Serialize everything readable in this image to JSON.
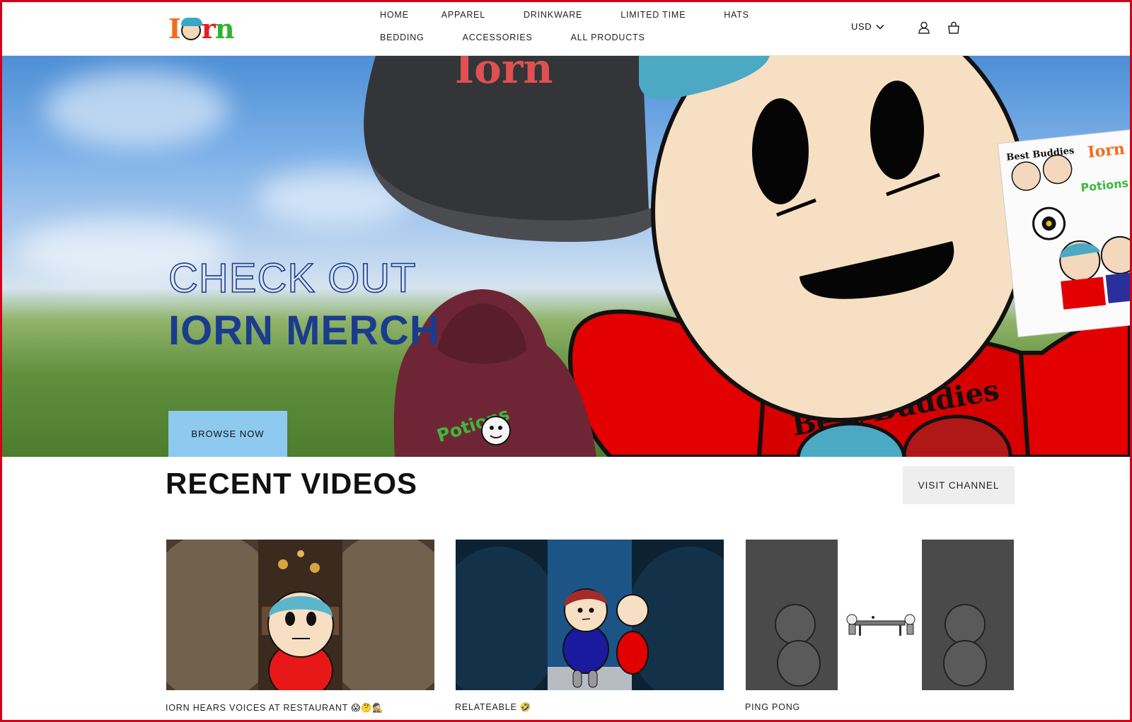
{
  "header": {
    "logo_text": "Iorn",
    "nav_row1": [
      "HOME",
      "APPAREL",
      "DRINKWARE",
      "LIMITED TIME",
      "HATS"
    ],
    "nav_row2": [
      "BEDDING",
      "ACCESSORIES",
      "ALL PRODUCTS"
    ],
    "currency": "USD"
  },
  "hero": {
    "line1": "CHECK OUT",
    "line2": "IORN MERCH",
    "cta": "BROWSE NOW",
    "hat_print": "Iorn",
    "hoodie_print": "Potions",
    "shirt_print": "Best Buddies",
    "card_title": "Best Buddies",
    "card_logo": "Iorn",
    "card_print": "Potions"
  },
  "videos": {
    "title": "RECENT VIDEOS",
    "visit_label": "VISIT CHANNEL",
    "items": [
      {
        "title": "IORN HEARS VOICES AT RESTAURANT 😱🤔🕵️"
      },
      {
        "title": "RELATEABLE 🤣"
      },
      {
        "title": "PING PONG"
      }
    ]
  },
  "colors": {
    "brand_blue": "#1b3c8d",
    "cta_blue": "#8ec9ef",
    "frame_red": "#d0021b"
  }
}
